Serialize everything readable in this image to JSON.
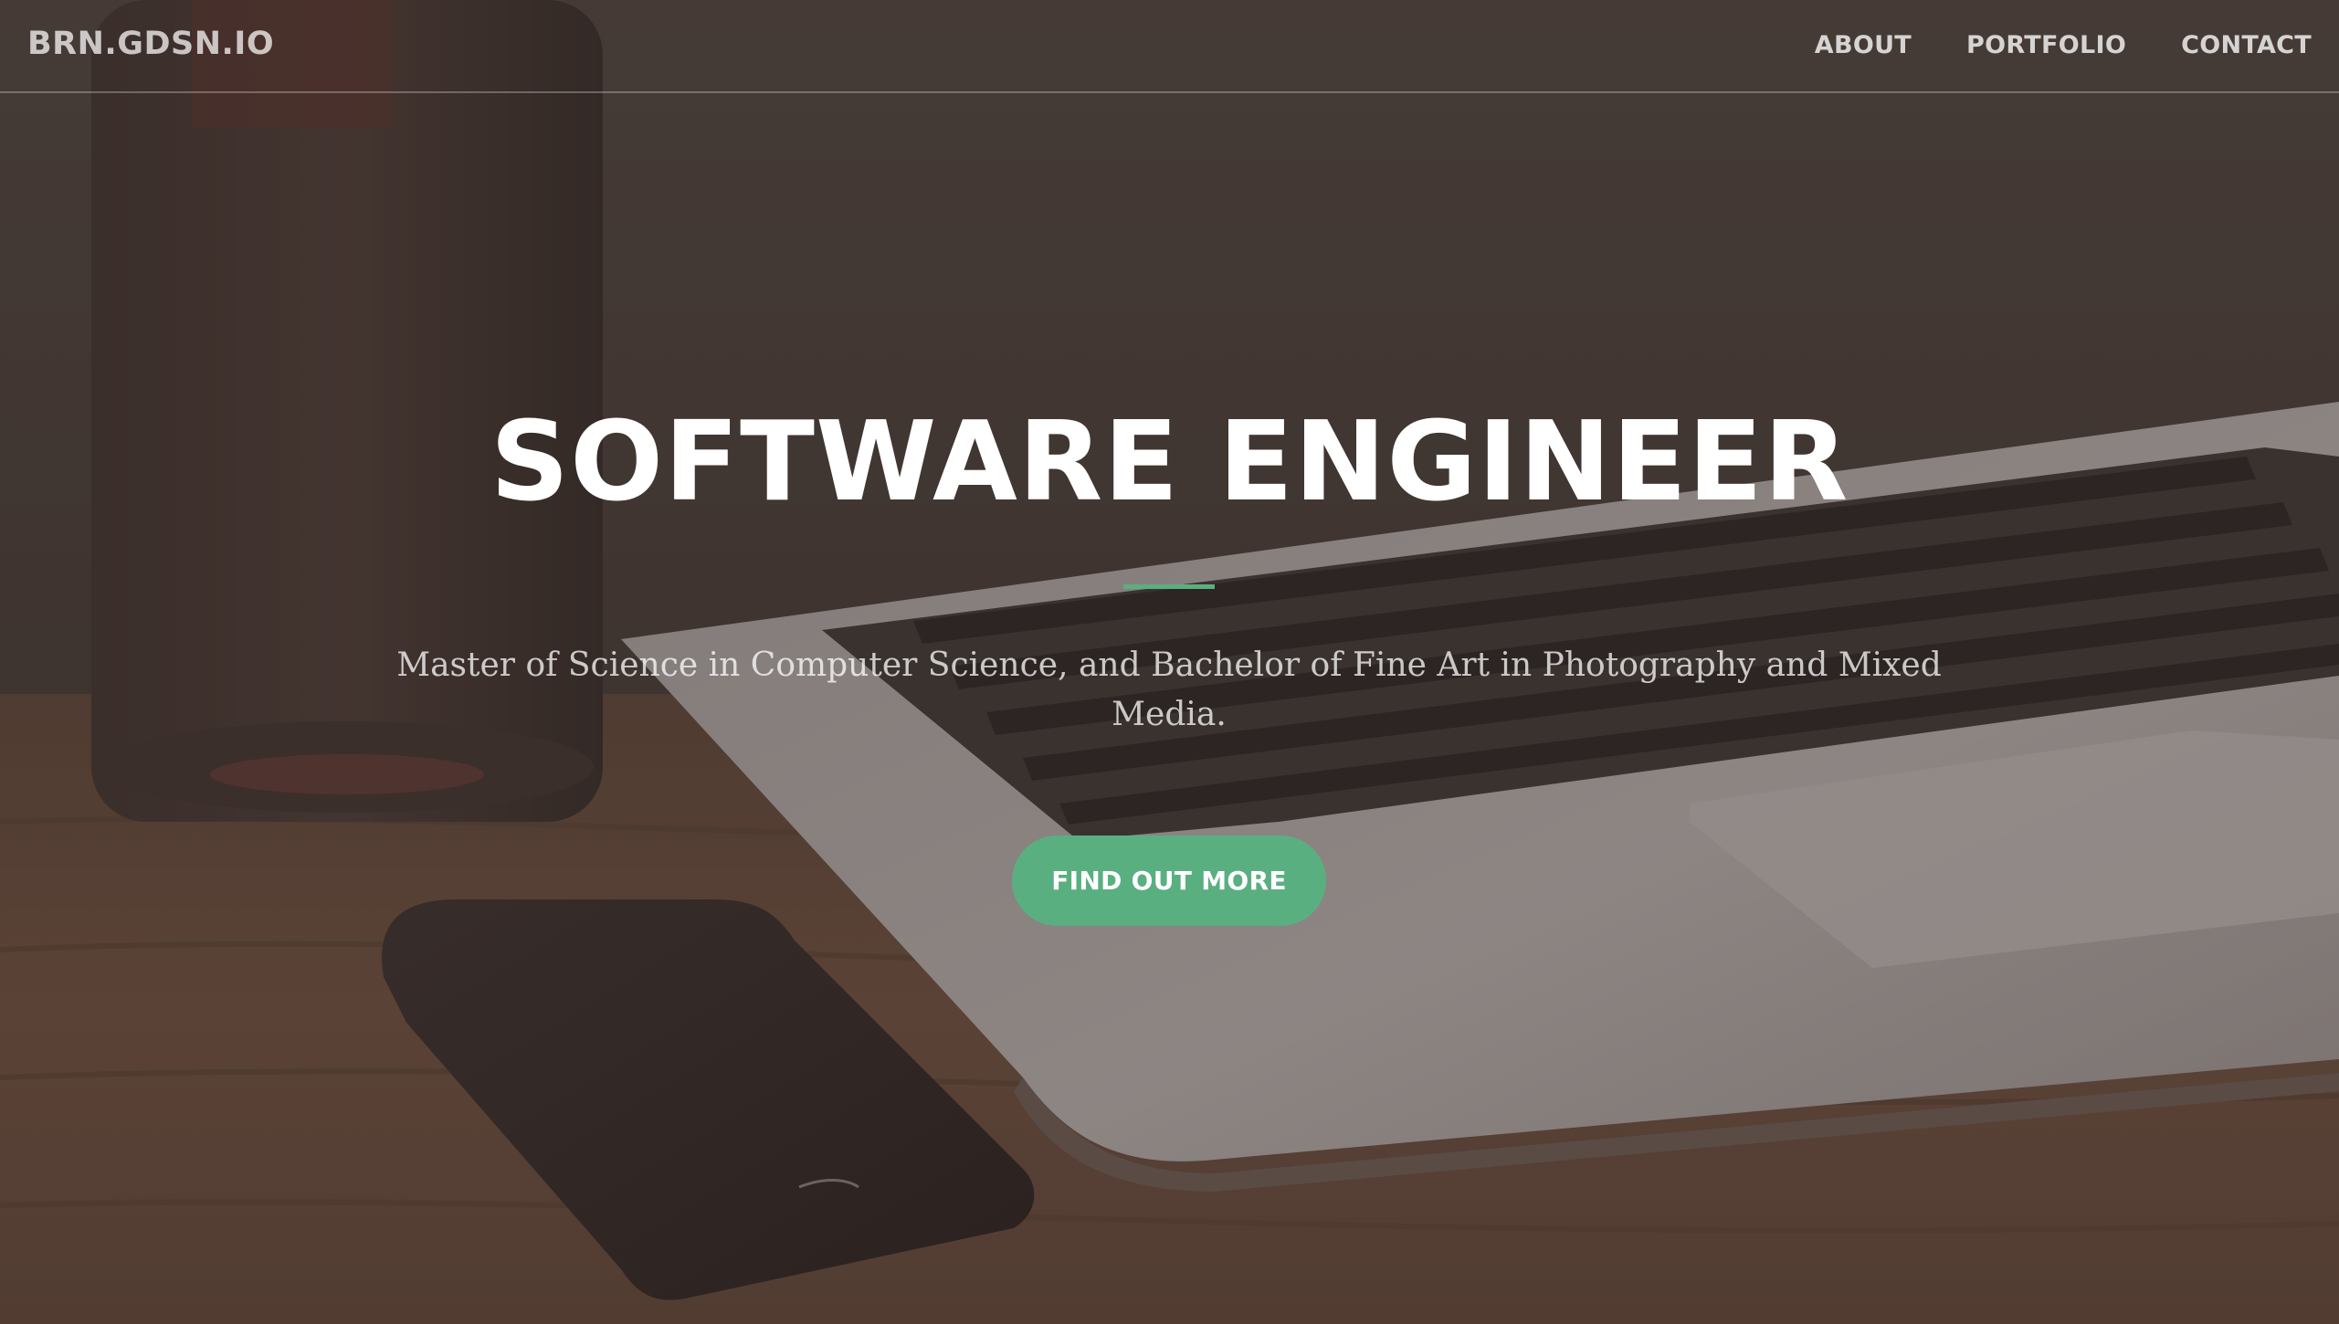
{
  "navbar": {
    "brand": "BRN.GDSN.IO",
    "links": [
      {
        "label": "ABOUT"
      },
      {
        "label": "PORTFOLIO"
      },
      {
        "label": "CONTACT"
      }
    ]
  },
  "hero": {
    "title": "SOFTWARE ENGINEER",
    "subtitle": "Master of Science in Computer Science, and Bachelor of Fine Art in Photography and Mixed Media.",
    "cta_label": "FIND OUT MORE",
    "background_image": "laptop-phone-desk-photo"
  },
  "colors": {
    "accent": "#5aaf80",
    "overlay": "#3c302c"
  }
}
